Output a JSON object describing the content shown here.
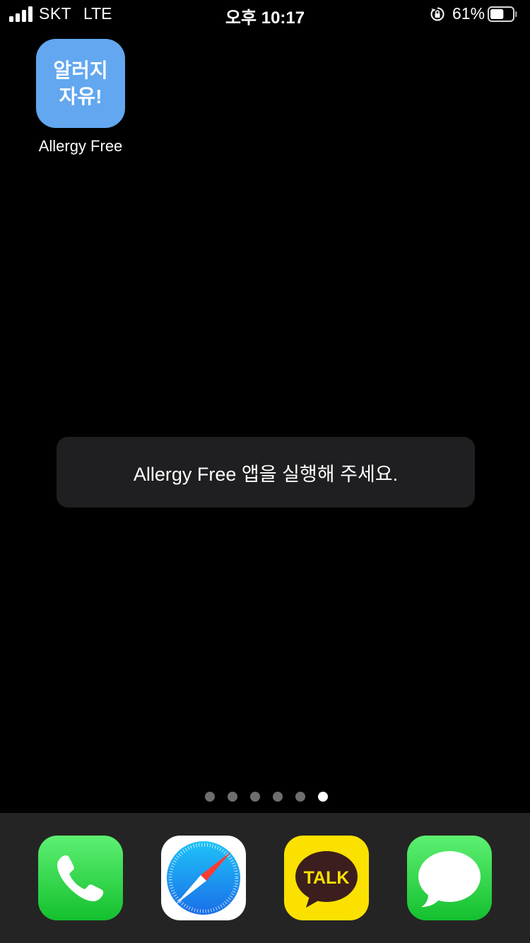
{
  "status_bar": {
    "carrier": "SKT",
    "network": "LTE",
    "time": "오후 10:17",
    "battery_percent": "61%",
    "battery_level": 0.61
  },
  "home_app": {
    "icon_line1": "알러지",
    "icon_line2": "자유!",
    "label": "Allergy Free",
    "tile_color": "#62a7ef"
  },
  "toast": {
    "message": "Allergy Free 앱을 실행해 주세요."
  },
  "page_indicator": {
    "total": 6,
    "current": 6
  },
  "dock": {
    "apps": [
      {
        "icon": "phone-icon"
      },
      {
        "icon": "safari-compass-icon"
      },
      {
        "icon": "kakaotalk-icon",
        "text": "TALK"
      },
      {
        "icon": "messages-icon"
      }
    ]
  }
}
